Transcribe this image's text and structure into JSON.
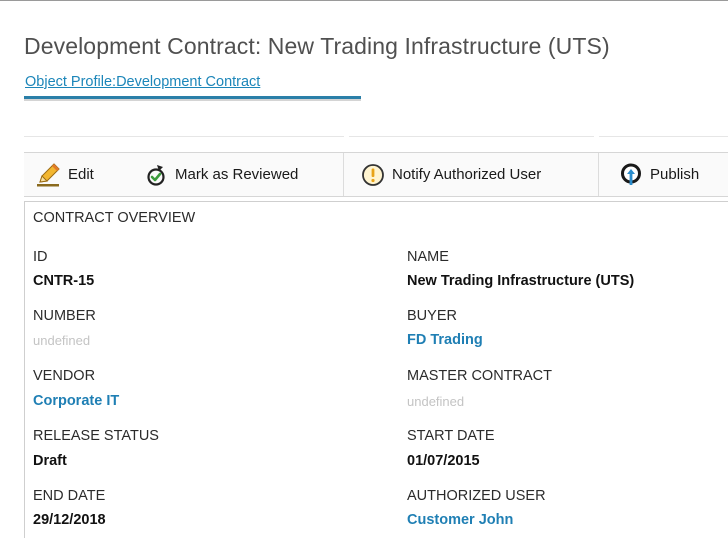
{
  "page": {
    "title": "Development Contract: New Trading Infrastructure (UTS)",
    "profile_link": "Object Profile:Development Contract"
  },
  "toolbar": {
    "edit_label": "Edit",
    "mark_reviewed_label": "Mark as Reviewed",
    "notify_label": "Notify Authorized User",
    "publish_label": "Publish"
  },
  "overview": {
    "section_title": "CONTRACT OVERVIEW",
    "fields": [
      {
        "label": "ID",
        "value": "CNTR-15",
        "style": "bold"
      },
      {
        "label": "NAME",
        "value": "New Trading Infrastructure (UTS)",
        "style": "bold"
      },
      {
        "label": "NUMBER",
        "value": "undefined",
        "style": "undefined"
      },
      {
        "label": "BUYER",
        "value": "FD Trading",
        "style": "link"
      },
      {
        "label": "VENDOR",
        "value": "Corporate IT",
        "style": "link"
      },
      {
        "label": "MASTER CONTRACT",
        "value": "undefined",
        "style": "undefined"
      },
      {
        "label": "RELEASE STATUS",
        "value": "Draft",
        "style": "bold"
      },
      {
        "label": "START DATE",
        "value": "01/07/2015",
        "style": "bold"
      },
      {
        "label": "END DATE",
        "value": "29/12/2018",
        "style": "bold"
      },
      {
        "label": "AUTHORIZED USER",
        "value": "Customer John",
        "style": "link"
      }
    ]
  },
  "colors": {
    "link": "#1f7fb4",
    "accent_underline": "#2a7fa8",
    "undefined_text": "#c4c4c4"
  }
}
